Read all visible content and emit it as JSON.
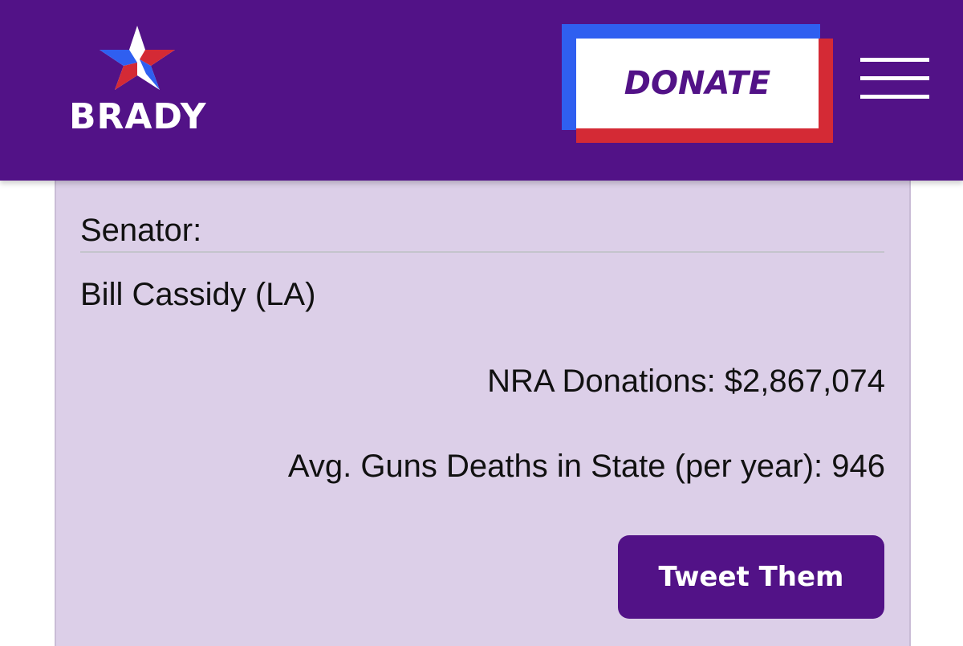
{
  "header": {
    "logo_text": "BRADY",
    "donate_label": "DONATE",
    "menu_icon": "hamburger-menu-icon"
  },
  "card": {
    "role_label": "Senator:",
    "name": "Bill Cassidy (LA)",
    "nra_donations": "NRA Donations: $2,867,074",
    "gun_deaths": "Avg. Guns Deaths in State (per year): 946",
    "tweet_label": "Tweet Them"
  },
  "colors": {
    "brand_purple": "#521287",
    "card_background": "#dccfe8",
    "accent_blue": "#2f5ff0",
    "accent_red": "#d42a35"
  }
}
